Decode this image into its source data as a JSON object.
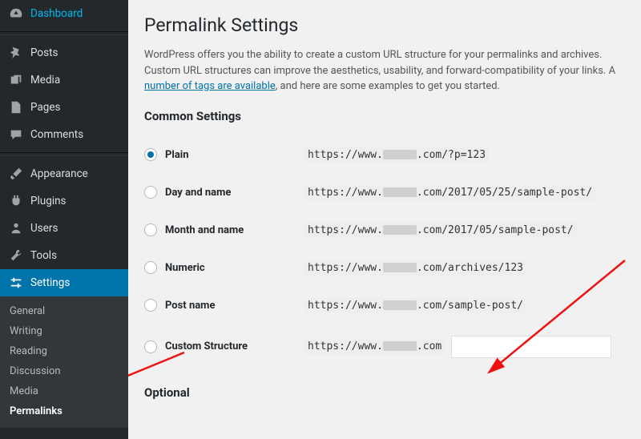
{
  "sidebar": {
    "items": {
      "dashboard": "Dashboard",
      "posts": "Posts",
      "media": "Media",
      "pages": "Pages",
      "comments": "Comments",
      "appearance": "Appearance",
      "plugins": "Plugins",
      "users": "Users",
      "tools": "Tools",
      "settings": "Settings"
    },
    "sub": {
      "general": "General",
      "writing": "Writing",
      "reading": "Reading",
      "discussion": "Discussion",
      "media": "Media",
      "permalinks": "Permalinks"
    }
  },
  "page": {
    "title": "Permalink Settings",
    "intro_1": "WordPress offers you the ability to create a custom URL structure for your permalinks and archives. Custom URL structures can improve the aesthetics, usability, and forward-compatibility of your links. A ",
    "tags_link": "number of tags are available",
    "intro_2": ", and here are some examples to get you started.",
    "common_heading": "Common Settings",
    "optional_heading": "Optional"
  },
  "options": {
    "plain": {
      "label": "Plain",
      "url_pre": "https://www.",
      "url_post": ".com/?p=123"
    },
    "dayname": {
      "label": "Day and name",
      "url_pre": "https://www.",
      "url_post": ".com/2017/05/25/sample-post/"
    },
    "monthname": {
      "label": "Month and name",
      "url_pre": "https://www.",
      "url_post": ".com/2017/05/sample-post/"
    },
    "numeric": {
      "label": "Numeric",
      "url_pre": "https://www.",
      "url_post": ".com/archives/123"
    },
    "postname": {
      "label": "Post name",
      "url_pre": "https://www.",
      "url_post": ".com/sample-post/"
    },
    "custom": {
      "label": "Custom Structure",
      "url_pre": "https://www.",
      "url_post": ".com"
    }
  }
}
